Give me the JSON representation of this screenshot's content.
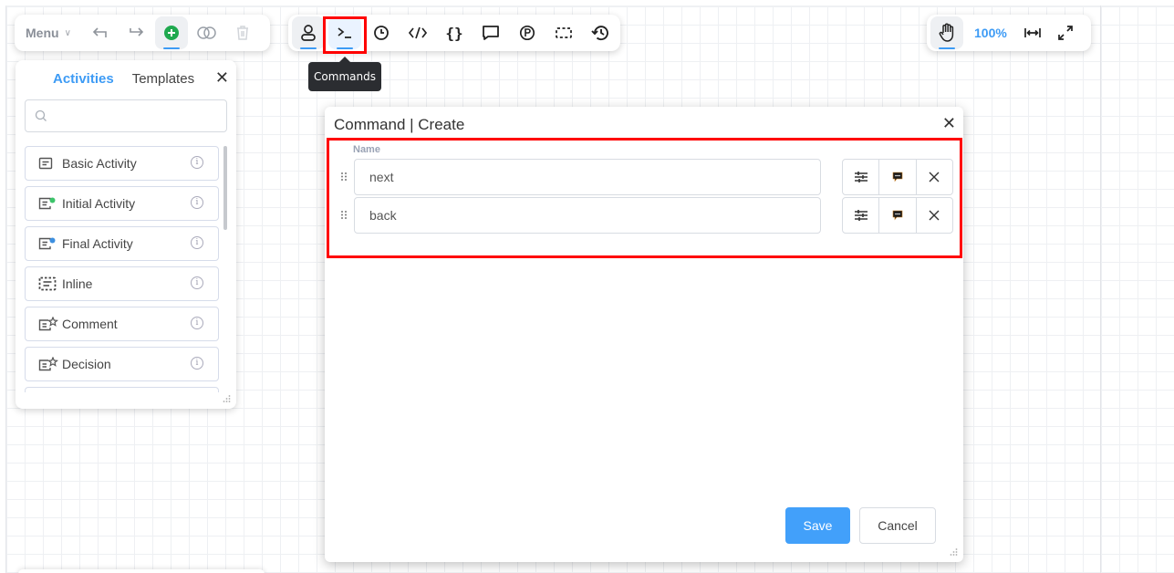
{
  "toolbar_left": {
    "menu_label": "Menu",
    "icons": [
      "undo-icon",
      "redo-icon",
      "add-icon",
      "toggle-icon",
      "delete-icon"
    ]
  },
  "toolbar_mid": {
    "icons": [
      "user-icon",
      "commands-icon",
      "clock-icon",
      "code-icon",
      "braces-icon",
      "comment-icon",
      "parking-icon",
      "selection-icon",
      "history-icon"
    ],
    "tooltip": "Commands"
  },
  "toolbar_right": {
    "zoom_level": "100%",
    "icons": [
      "hand-icon",
      "fit-width-icon",
      "fullscreen-icon"
    ]
  },
  "activities_panel": {
    "tabs": [
      {
        "label": "Activities",
        "active": true
      },
      {
        "label": "Templates",
        "active": false
      }
    ],
    "search_placeholder": "",
    "items": [
      {
        "label": "Basic Activity",
        "icon": "basic-activity-icon"
      },
      {
        "label": "Initial Activity",
        "icon": "initial-activity-icon",
        "dot_color": "#3cc46a"
      },
      {
        "label": "Final Activity",
        "icon": "final-activity-icon",
        "dot_color": "#3d8fe0"
      },
      {
        "label": "Inline",
        "icon": "inline-icon"
      },
      {
        "label": "Comment",
        "icon": "comment-activity-icon"
      },
      {
        "label": "Decision",
        "icon": "decision-icon"
      }
    ]
  },
  "dialog": {
    "title": "Command | Create",
    "field_label": "Name",
    "commands": [
      {
        "value": "next"
      },
      {
        "value": "back"
      }
    ],
    "save_label": "Save",
    "cancel_label": "Cancel"
  },
  "colors": {
    "accent": "#3d9bf5",
    "save_button": "#42a0fa",
    "highlight": "#ff0000",
    "add_green": "#1fa94f"
  }
}
